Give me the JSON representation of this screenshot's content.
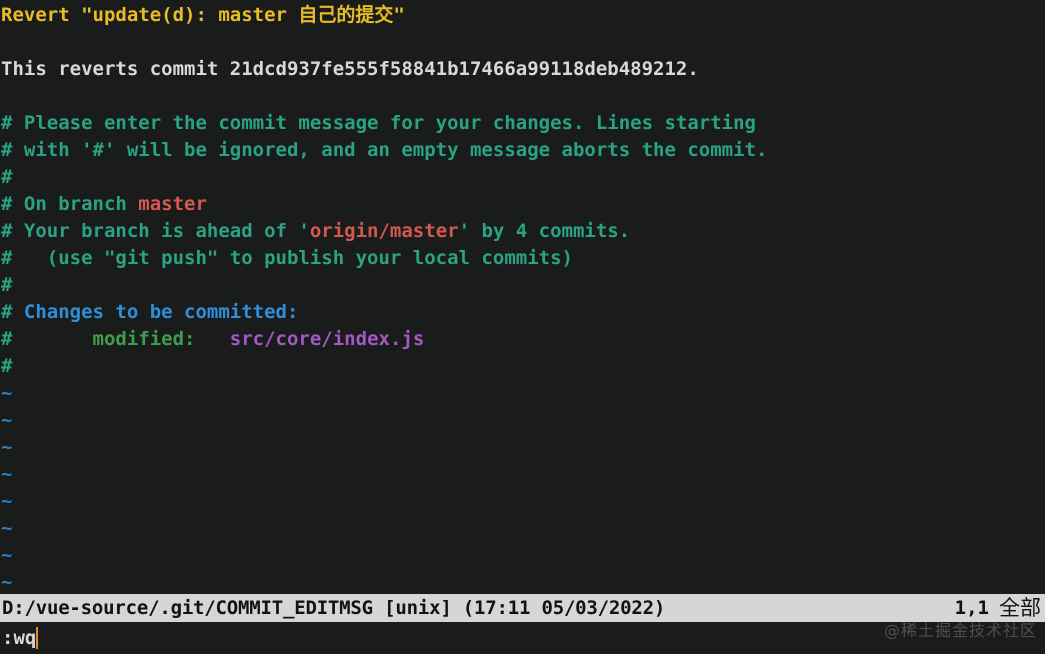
{
  "app": {
    "name": "vim",
    "background": "#1a1b1b"
  },
  "colors": {
    "subject": "#e8bd24",
    "body_text": "#d8d8d8",
    "comment": "#29a383",
    "branch_name": "#d4584f",
    "section_header": "#2f8fd8",
    "staged_label": "#3f9e4d",
    "file_path": "#a458c4",
    "tilde": "#2b7ec4",
    "statusline_bg": "#d6d6d6",
    "statusline_fg": "#111213",
    "cursor": "#e08c28"
  },
  "buffer": {
    "lines": [
      {
        "id": "subject",
        "kind": "subject",
        "text": "Revert \"update(d): master 自己的提交\""
      },
      {
        "id": "blank-1",
        "kind": "blank",
        "text": ""
      },
      {
        "id": "revert-body",
        "kind": "body",
        "text": "This reverts commit 21dcd937fe555f58841b17466a99118deb489212."
      },
      {
        "id": "blank-2",
        "kind": "blank",
        "text": ""
      },
      {
        "id": "comment-1",
        "kind": "comment",
        "text": "# Please enter the commit message for your changes. Lines starting"
      },
      {
        "id": "comment-2",
        "kind": "comment",
        "text": "# with '#' will be ignored, and an empty message aborts the commit."
      },
      {
        "id": "comment-3",
        "kind": "comment",
        "text": "#"
      },
      {
        "id": "comment-branch",
        "kind": "segments",
        "segments": [
          {
            "text": "# On branch ",
            "color": "comment"
          },
          {
            "text": "master",
            "color": "branch_name"
          }
        ]
      },
      {
        "id": "comment-ahead",
        "kind": "segments",
        "segments": [
          {
            "text": "# Your branch is ahead of '",
            "color": "comment"
          },
          {
            "text": "origin/master",
            "color": "branch_name"
          },
          {
            "text": "' by 4 commits.",
            "color": "comment"
          }
        ]
      },
      {
        "id": "comment-push",
        "kind": "comment",
        "text": "#   (use \"git push\" to publish your local commits)"
      },
      {
        "id": "comment-4",
        "kind": "comment",
        "text": "#"
      },
      {
        "id": "comment-staged",
        "kind": "segments",
        "segments": [
          {
            "text": "# ",
            "color": "comment"
          },
          {
            "text": "Changes to be committed:",
            "color": "section_header"
          }
        ]
      },
      {
        "id": "comment-modified",
        "kind": "segments",
        "segments": [
          {
            "text": "#       ",
            "color": "comment"
          },
          {
            "text": "modified:   ",
            "color": "staged_label"
          },
          {
            "text": "src/core/index.js",
            "color": "file_path"
          }
        ]
      },
      {
        "id": "comment-5",
        "kind": "comment",
        "text": "#"
      },
      {
        "id": "tilde-1",
        "kind": "tilde",
        "text": "~"
      },
      {
        "id": "tilde-2",
        "kind": "tilde",
        "text": "~"
      },
      {
        "id": "tilde-3",
        "kind": "tilde",
        "text": "~"
      },
      {
        "id": "tilde-4",
        "kind": "tilde",
        "text": "~"
      },
      {
        "id": "tilde-5",
        "kind": "tilde",
        "text": "~"
      },
      {
        "id": "tilde-6",
        "kind": "tilde",
        "text": "~"
      },
      {
        "id": "tilde-7",
        "kind": "tilde",
        "text": "~"
      },
      {
        "id": "tilde-8",
        "kind": "tilde",
        "text": "~"
      }
    ]
  },
  "statusline": {
    "file_info": "D:/vue-source/.git/COMMIT_EDITMSG [unix] (17:11 05/03/2022)",
    "ruler": "1,1",
    "percent": "全部"
  },
  "cmdline": {
    "text": ":wq"
  },
  "watermark": {
    "text": "@稀土掘金技术社区"
  }
}
